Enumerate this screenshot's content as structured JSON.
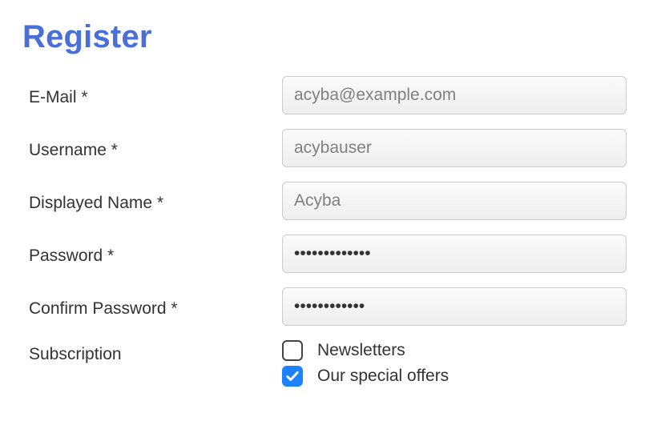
{
  "title": "Register",
  "labels": {
    "email": "E-Mail *",
    "username": "Username *",
    "displayedName": "Displayed Name *",
    "password": "Password *",
    "confirmPassword": "Confirm Password *",
    "subscription": "Subscription"
  },
  "placeholders": {
    "email": "acyba@example.com",
    "username": "acybauser",
    "displayedName": "Acyba"
  },
  "values": {
    "password": "•••••••••••••",
    "confirmPassword": "••••••••••••"
  },
  "subscription": {
    "options": [
      {
        "label": "Newsletters",
        "checked": false
      },
      {
        "label": "Our special offers",
        "checked": true
      }
    ]
  }
}
